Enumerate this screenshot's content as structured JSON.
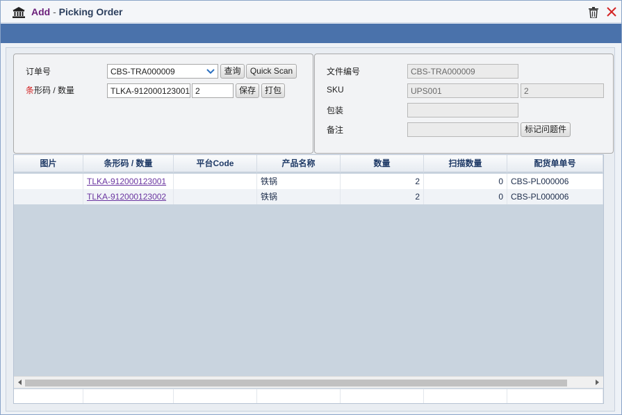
{
  "window": {
    "title_add": "Add",
    "title_sep": "-",
    "title_main": "Picking Order",
    "icons": [
      "bank-icon",
      "trash-icon",
      "close-icon"
    ]
  },
  "form": {
    "order_label": "订单号",
    "order_value": "CBS-TRA000009",
    "query_button": "查询",
    "quick_scan_button": "Quick Scan",
    "barcode_label_red": "条",
    "barcode_label_rest": "形码 / 数量",
    "barcode_value": "TLKA-912000123001",
    "qty_value": "2",
    "save_button": "保存",
    "pack_button": "打包"
  },
  "info": {
    "doc_no_label": "文件编号",
    "doc_no_value": "CBS-TRA000009",
    "sku_label": "SKU",
    "sku_value": "UPS001",
    "sku_qty_value": "2",
    "pack_label": "包装",
    "pack_value": "",
    "note_label": "备注",
    "note_value": "",
    "mark_button": "标记问题件"
  },
  "grid": {
    "columns": [
      "图片",
      "条形码 / 数量",
      "平台Code",
      "产品名称",
      "数量",
      "扫描数量",
      "配货单单号"
    ],
    "rows": [
      {
        "image": "",
        "barcode": "TLKA-912000123001",
        "platform_code": "",
        "product_name": "铁锅",
        "qty": "2",
        "scanned": "0",
        "picking_no": "CBS-PL000006"
      },
      {
        "image": "",
        "barcode": "TLKA-912000123002",
        "platform_code": "",
        "product_name": "铁锅",
        "qty": "2",
        "scanned": "0",
        "picking_no": "CBS-PL000006"
      }
    ]
  },
  "colors": {
    "title_add": "#6b1f7a",
    "header_bar": "#4a72ab",
    "required_mark": "#d21e1e",
    "link": "#6a35a0"
  }
}
